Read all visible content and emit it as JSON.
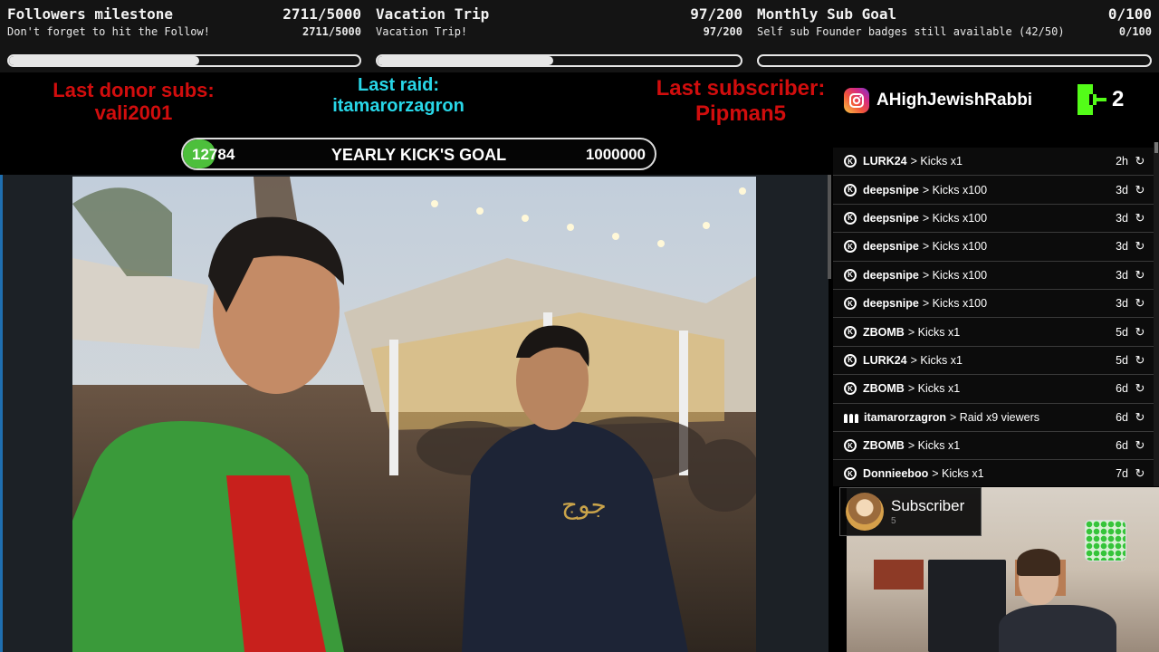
{
  "goals": [
    {
      "title": "Followers milestone",
      "count": "2711/5000",
      "subtitle": "Don't forget to hit the Follow!",
      "subcount": "2711/5000",
      "progress": 0.5422
    },
    {
      "title": "Vacation Trip",
      "count": "97/200",
      "subtitle": "Vacation Trip!",
      "subcount": "97/200",
      "progress": 0.485
    },
    {
      "title": "Monthly Sub Goal",
      "count": "0/100",
      "subtitle": "Self sub Founder badges still available (42/50)",
      "subcount": "0/100",
      "progress": 0.0
    }
  ],
  "labels": {
    "donor_title": "Last donor subs:",
    "donor_name": "vali2001",
    "raid_title": "Last raid:",
    "raid_name": "itamarorzagron",
    "subscriber_title": "Last subscriber:",
    "subscriber_name": "Pipman5"
  },
  "instagram": {
    "icon": "instagram-icon",
    "handle": "AHighJewishRabbi"
  },
  "kick": {
    "icon": "kick-logo-icon",
    "count": "2"
  },
  "yearly_goal": {
    "current": "12784",
    "label": "YEARLY KICK'S GOAL",
    "target": "1000000",
    "progress": 0.012784,
    "color": "#4dbf3c"
  },
  "events": [
    {
      "user": "LURK24",
      "action": "> Kicks x1",
      "time": "2h",
      "icon": "kick-icon"
    },
    {
      "user": "deepsnipe",
      "action": "> Kicks x100",
      "time": "3d",
      "icon": "kick-icon"
    },
    {
      "user": "deepsnipe",
      "action": "> Kicks x100",
      "time": "3d",
      "icon": "kick-icon"
    },
    {
      "user": "deepsnipe",
      "action": "> Kicks x100",
      "time": "3d",
      "icon": "kick-icon"
    },
    {
      "user": "deepsnipe",
      "action": "> Kicks x100",
      "time": "3d",
      "icon": "kick-icon"
    },
    {
      "user": "deepsnipe",
      "action": "> Kicks x100",
      "time": "3d",
      "icon": "kick-icon"
    },
    {
      "user": "ZBOMB",
      "action": "> Kicks x1",
      "time": "5d",
      "icon": "kick-icon"
    },
    {
      "user": "LURK24",
      "action": "> Kicks x1",
      "time": "5d",
      "icon": "kick-icon"
    },
    {
      "user": "ZBOMB",
      "action": "> Kicks x1",
      "time": "6d",
      "icon": "kick-icon"
    },
    {
      "user": "itamarorzagron",
      "action": "> Raid x9 viewers",
      "time": "6d",
      "icon": "raid-icon"
    },
    {
      "user": "ZBOMB",
      "action": "> Kicks x1",
      "time": "6d",
      "icon": "kick-icon"
    },
    {
      "user": "Donnieeboo",
      "action": "> Kicks x1",
      "time": "7d",
      "icon": "kick-icon"
    }
  ],
  "subscriber_alert": {
    "title": "Subscriber",
    "count": "5"
  },
  "colors": {
    "red": "#d10d0d",
    "cyan": "#28d7e8",
    "kick_green": "#53fc18"
  }
}
